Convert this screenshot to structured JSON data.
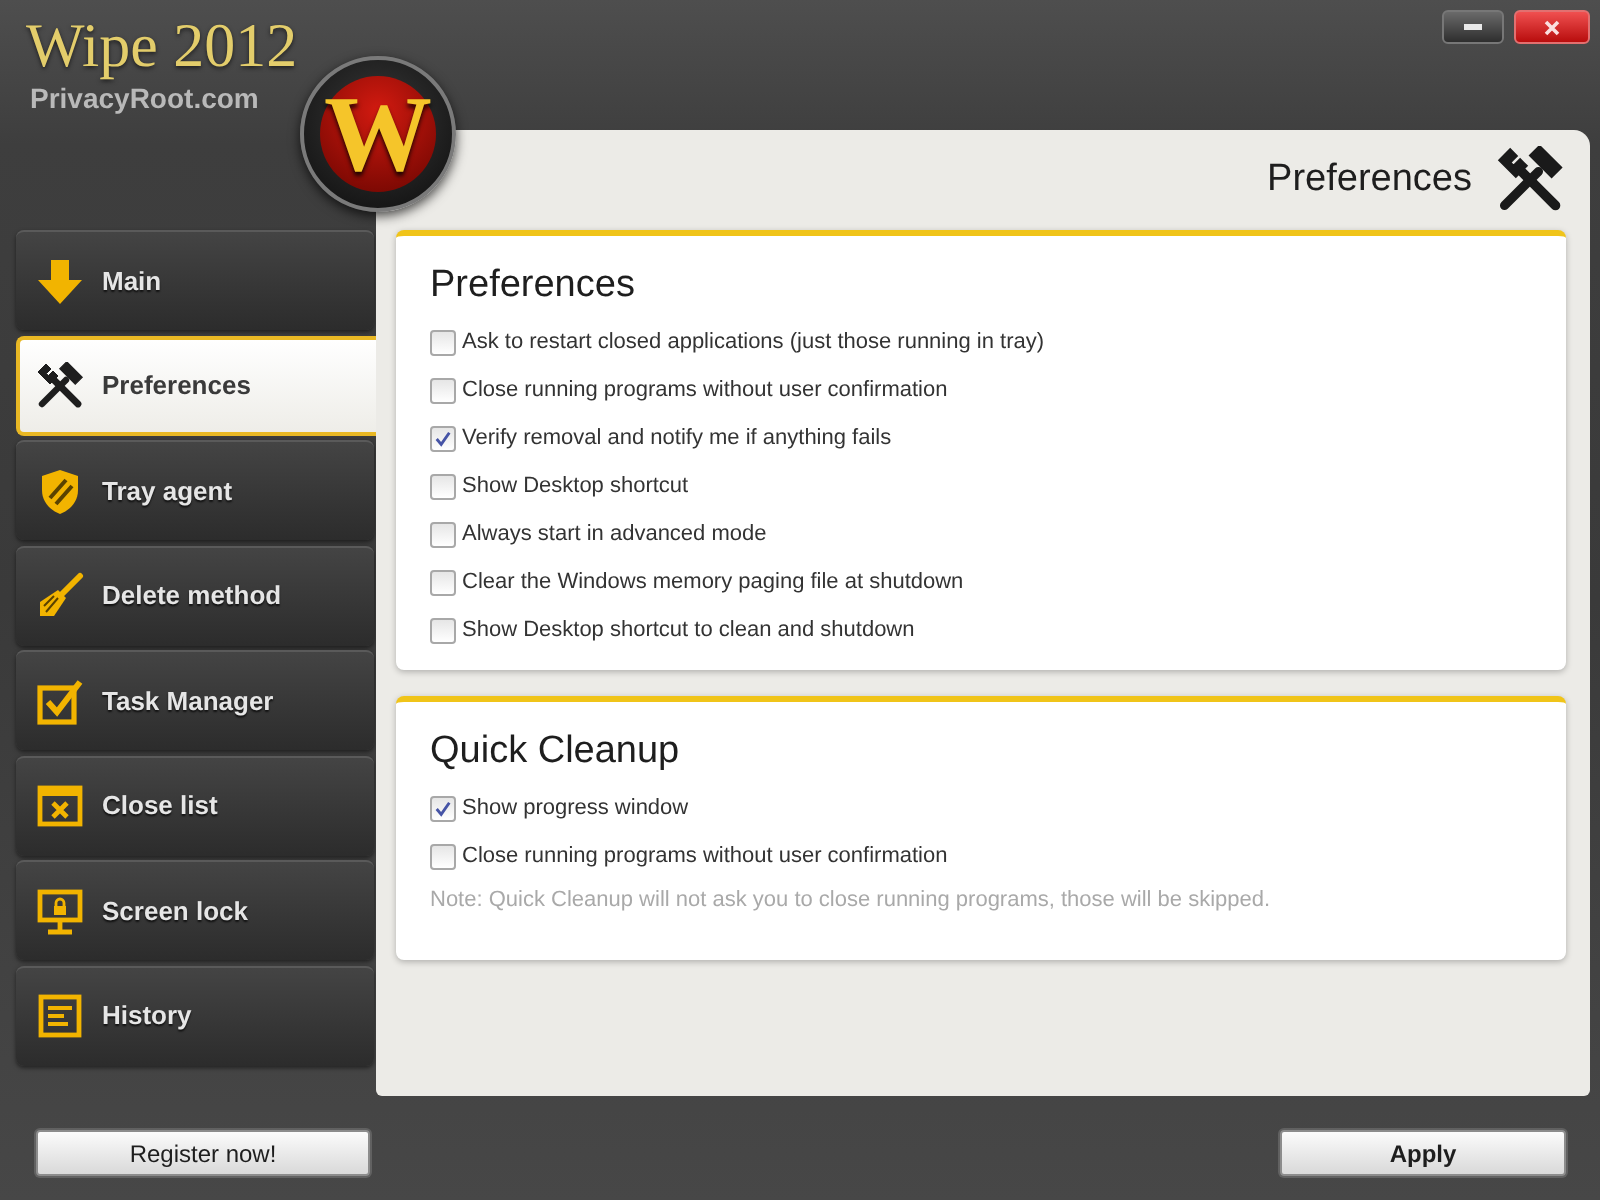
{
  "app": {
    "title": "Wipe 2012",
    "subtitle": "PrivacyRoot.com",
    "logo_letter": "W"
  },
  "sidebar": {
    "items": [
      {
        "label": "Main",
        "selected": false
      },
      {
        "label": "Preferences",
        "selected": true
      },
      {
        "label": "Tray agent",
        "selected": false
      },
      {
        "label": "Delete method",
        "selected": false
      },
      {
        "label": "Task Manager",
        "selected": false
      },
      {
        "label": "Close list",
        "selected": false
      },
      {
        "label": "Screen lock",
        "selected": false
      },
      {
        "label": "History",
        "selected": false
      }
    ]
  },
  "page_header": {
    "title": "Preferences"
  },
  "sections": [
    {
      "title": "Preferences",
      "options": [
        {
          "label": "Ask to restart closed applications (just those running in tray)",
          "checked": false
        },
        {
          "label": "Close running programs without user confirmation",
          "checked": false
        },
        {
          "label": "Verify removal and notify me if anything fails",
          "checked": true
        },
        {
          "label": "Show Desktop shortcut",
          "checked": false
        },
        {
          "label": "Always start in advanced mode",
          "checked": false
        },
        {
          "label": "Clear the Windows memory paging file at shutdown",
          "checked": false
        },
        {
          "label": "Show Desktop shortcut to clean and shutdown",
          "checked": false
        }
      ]
    },
    {
      "title": "Quick Cleanup",
      "options": [
        {
          "label": "Show progress window",
          "checked": true
        },
        {
          "label": "Close running programs without user confirmation",
          "checked": false
        }
      ],
      "note": "Note: Quick Cleanup will not ask you to close running programs, those will be skipped."
    }
  ],
  "footer": {
    "buttons": [
      {
        "label": "Register now!",
        "kind": "secondary"
      },
      {
        "label": "Apply",
        "kind": "primary"
      }
    ]
  }
}
